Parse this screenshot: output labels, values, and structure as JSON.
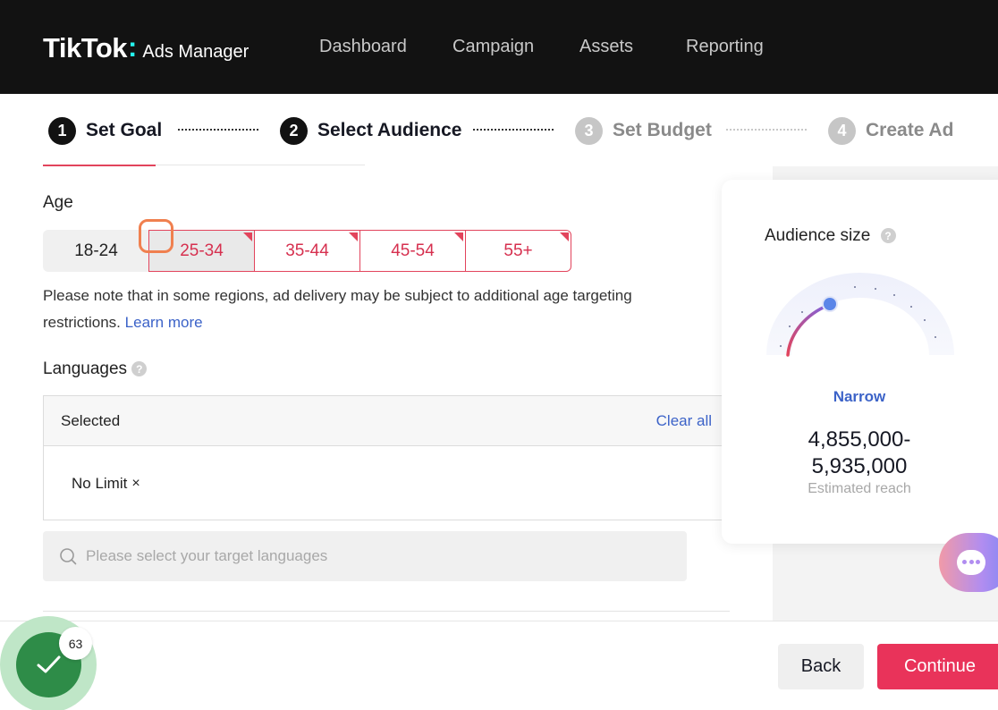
{
  "header": {
    "logo_main": "TikTok",
    "logo_sub": "Ads Manager",
    "nav": [
      "Dashboard",
      "Campaign",
      "Assets",
      "Reporting"
    ]
  },
  "steps": [
    {
      "num": "1",
      "label": "Set Goal",
      "state": "done"
    },
    {
      "num": "2",
      "label": "Select Audience",
      "state": "active"
    },
    {
      "num": "3",
      "label": "Set Budget",
      "state": "upcoming"
    },
    {
      "num": "4",
      "label": "Create Ad",
      "state": "upcoming"
    }
  ],
  "age": {
    "title": "Age",
    "options": [
      "18-24",
      "25-34",
      "35-44",
      "45-54",
      "55+"
    ],
    "note": "Please note that in some regions, ad delivery may be subject to additional age targeting restrictions.",
    "learn_more": "Learn more"
  },
  "languages": {
    "title": "Languages",
    "help": "?",
    "selected_label": "Selected",
    "clear_all": "Clear all",
    "chip": "No Limit",
    "chip_remove": "×",
    "search_placeholder": "Please select your target languages"
  },
  "audience": {
    "title": "Audience size",
    "help": "?",
    "level": "Narrow",
    "range": "4,855,000-5,935,000",
    "range_line1": "4,855,000-",
    "range_line2": "5,935,000",
    "range_caption": "Estimated reach"
  },
  "footer": {
    "back": "Back",
    "continue": "Continue"
  },
  "badge": {
    "count": "63"
  },
  "colors": {
    "accent": "#e9335a",
    "link": "#3c63c8",
    "header_bg": "#121212",
    "badge_green": "#2e8c48"
  }
}
